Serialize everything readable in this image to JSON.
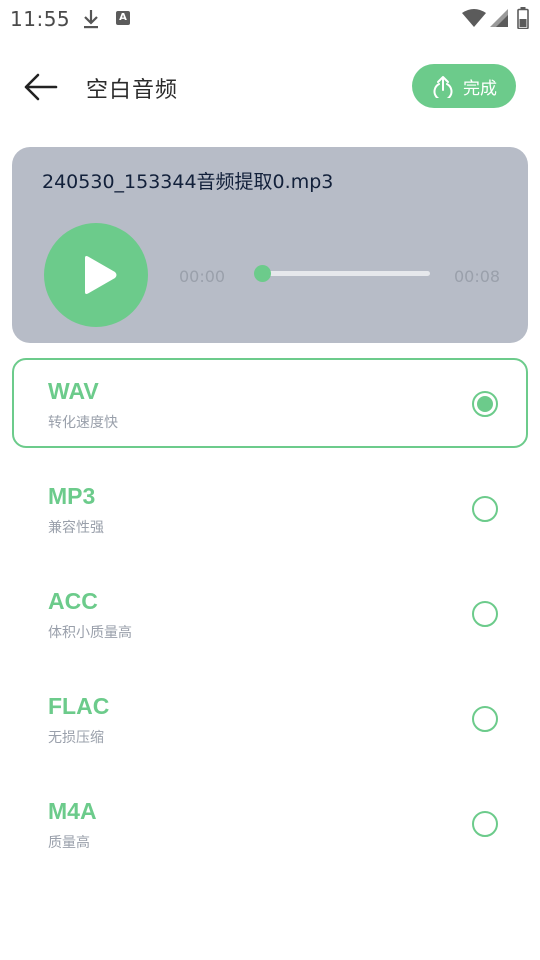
{
  "status_bar": {
    "time": "11:55",
    "icons": [
      "download-icon",
      "a-icon",
      "wifi-icon",
      "signal-icon",
      "battery-icon"
    ]
  },
  "header": {
    "title": "空白音频",
    "done_label": "完成",
    "back_icon": "arrow-left-icon",
    "upload_icon": "upload-icon"
  },
  "player": {
    "file_name": "240530_153344音频提取0.mp3",
    "time_current": "00:00",
    "time_total": "00:08",
    "progress": 0.0,
    "play_icon": "play-icon"
  },
  "formats": [
    {
      "name": "WAV",
      "desc": "转化速度快",
      "selected": true
    },
    {
      "name": "MP3",
      "desc": "兼容性强",
      "selected": false
    },
    {
      "name": "ACC",
      "desc": "体积小质量高",
      "selected": false
    },
    {
      "name": "FLAC",
      "desc": "无损压缩",
      "selected": false
    },
    {
      "name": "M4A",
      "desc": "质量高",
      "selected": false
    }
  ],
  "colors": {
    "accent": "#6ccb8b",
    "card_bg": "#b7bcc7",
    "muted_text": "#9aa0ab"
  }
}
